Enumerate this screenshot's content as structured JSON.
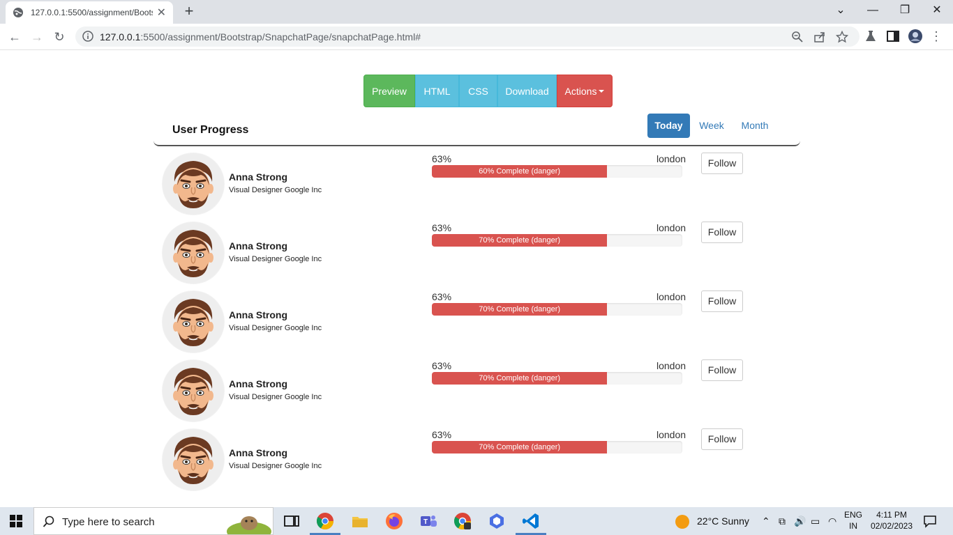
{
  "browser": {
    "tab_title": "127.0.0.1:5500/assignment/Bootstrap/SnapchatPage/snapchatPage.html#",
    "tab_title_visible": "127.0.0.1:5500/assignment/Boots",
    "url_host": "127.0.0.1",
    "url_rest": ":5500/assignment/Bootstrap/SnapchatPage/snapchatPage.html#",
    "new_tab": "+",
    "close": "✕"
  },
  "toolbar_buttons": {
    "preview": "Preview",
    "html": "HTML",
    "css": "CSS",
    "download": "Download",
    "actions": "Actions"
  },
  "panel": {
    "title": "User Progress",
    "tabs": [
      "Today",
      "Week",
      "Month"
    ],
    "active_tab": "Today"
  },
  "users": [
    {
      "name": "Anna Strong",
      "role": "Visual Designer Google Inc",
      "pct": "63%",
      "city": "london",
      "progress": 0.7,
      "bar_label": "60% Complete (danger)",
      "follow": "Follow"
    },
    {
      "name": "Anna Strong",
      "role": "Visual Designer Google Inc",
      "pct": "63%",
      "city": "london",
      "progress": 0.7,
      "bar_label": "70% Complete (danger)",
      "follow": "Follow"
    },
    {
      "name": "Anna Strong",
      "role": "Visual Designer Google Inc",
      "pct": "63%",
      "city": "london",
      "progress": 0.7,
      "bar_label": "70% Complete (danger)",
      "follow": "Follow"
    },
    {
      "name": "Anna Strong",
      "role": "Visual Designer Google Inc",
      "pct": "63%",
      "city": "london",
      "progress": 0.7,
      "bar_label": "70% Complete (danger)",
      "follow": "Follow"
    },
    {
      "name": "Anna Strong",
      "role": "Visual Designer Google Inc",
      "pct": "63%",
      "city": "london",
      "progress": 0.7,
      "bar_label": "70% Complete (danger)",
      "follow": "Follow"
    }
  ],
  "taskbar": {
    "search_placeholder": "Type here to search",
    "weather": "22°C  Sunny",
    "lang_top": "ENG",
    "lang_bottom": "IN",
    "time": "4:11 PM",
    "date": "02/02/2023"
  },
  "colors": {
    "success": "#5cb85c",
    "info": "#5bc0de",
    "danger": "#d9534f",
    "primary": "#337ab7"
  }
}
